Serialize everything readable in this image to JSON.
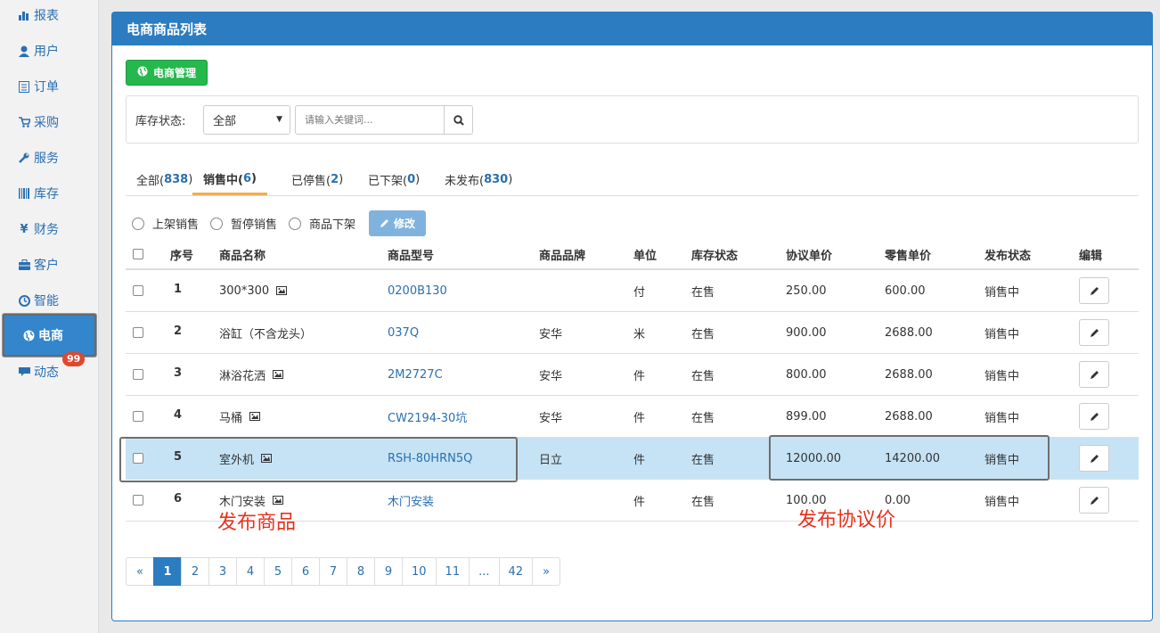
{
  "sidebar": {
    "items": [
      {
        "label": "报表",
        "icon": "bar-chart-icon"
      },
      {
        "label": "用户",
        "icon": "user-icon"
      },
      {
        "label": "订单",
        "icon": "list-icon"
      },
      {
        "label": "采购",
        "icon": "cart-icon"
      },
      {
        "label": "服务",
        "icon": "wrench-icon"
      },
      {
        "label": "库存",
        "icon": "barcode-icon"
      },
      {
        "label": "财务",
        "icon": "yen-icon"
      },
      {
        "label": "客户",
        "icon": "briefcase-icon"
      },
      {
        "label": "智能",
        "icon": "dashboard-icon"
      },
      {
        "label": "电商",
        "icon": "globe-icon"
      },
      {
        "label": "动态",
        "icon": "comment-icon",
        "badge": "99"
      }
    ]
  },
  "panel": {
    "title": "电商商品列表",
    "manage_button": "电商管理"
  },
  "filter": {
    "stock_label": "库存状态:",
    "stock_selected": "全部",
    "search_placeholder": "请输入关键词..."
  },
  "tabs": [
    {
      "label": "全部(",
      "count": "838",
      "close": ")"
    },
    {
      "label": "销售中(",
      "count": "6",
      "close": ")"
    },
    {
      "label": "已停售(",
      "count": "2",
      "close": ")"
    },
    {
      "label": "已下架(",
      "count": "0",
      "close": ")"
    },
    {
      "label": "未发布(",
      "count": "830",
      "close": ")"
    }
  ],
  "actions": {
    "radio_on_sale": "上架销售",
    "radio_pause": "暂停销售",
    "radio_off_shelf": "商品下架",
    "edit_button": "修改"
  },
  "table": {
    "headers": [
      "序号",
      "商品名称",
      "商品型号",
      "商品品牌",
      "单位",
      "库存状态",
      "协议单价",
      "零售单价",
      "发布状态",
      "编辑"
    ],
    "rows": [
      {
        "no": "1",
        "name": "300*300",
        "has_image": true,
        "model": "0200B130",
        "brand": "",
        "unit": "付",
        "stock": "在售",
        "agreed_price": "250.00",
        "retail_price": "600.00",
        "status": "销售中"
      },
      {
        "no": "2",
        "name": "浴缸（不含龙头）",
        "has_image": false,
        "model": "037Q",
        "brand": "安华",
        "unit": "米",
        "stock": "在售",
        "agreed_price": "900.00",
        "retail_price": "2688.00",
        "status": "销售中"
      },
      {
        "no": "3",
        "name": "淋浴花洒",
        "has_image": true,
        "model": "2M2727C",
        "brand": "安华",
        "unit": "件",
        "stock": "在售",
        "agreed_price": "800.00",
        "retail_price": "2688.00",
        "status": "销售中"
      },
      {
        "no": "4",
        "name": "马桶",
        "has_image": true,
        "model": "CW2194-30坑",
        "brand": "安华",
        "unit": "件",
        "stock": "在售",
        "agreed_price": "899.00",
        "retail_price": "2688.00",
        "status": "销售中"
      },
      {
        "no": "5",
        "name": "室外机",
        "has_image": true,
        "model": "RSH-80HRN5Q",
        "brand": "日立",
        "unit": "件",
        "stock": "在售",
        "agreed_price": "12000.00",
        "retail_price": "14200.00",
        "status": "销售中"
      },
      {
        "no": "6",
        "name": "木门安装",
        "has_image": true,
        "model": "木门安装",
        "brand": "",
        "unit": "件",
        "stock": "在售",
        "agreed_price": "100.00",
        "retail_price": "0.00",
        "status": "销售中"
      }
    ]
  },
  "pagination": [
    "«",
    "1",
    "2",
    "3",
    "4",
    "5",
    "6",
    "7",
    "8",
    "9",
    "10",
    "11",
    "...",
    "42",
    "»"
  ],
  "pagination_active": "1",
  "annotations": {
    "publish_product": "发布商品",
    "publish_agreed_price": "发布协议价"
  },
  "colors": {
    "primary": "#2b7cc0",
    "success": "#25b84d",
    "highlight_row": "#c6e3f5",
    "annotation": "#e8301c",
    "badge": "#e0472f"
  }
}
